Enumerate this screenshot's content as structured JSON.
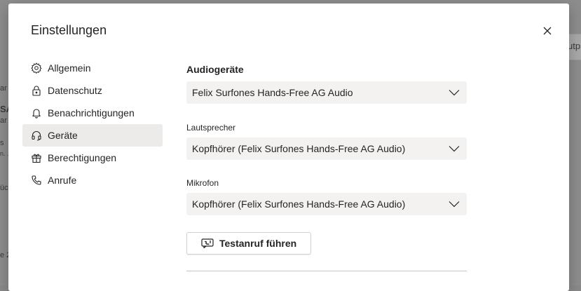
{
  "background": {
    "fragments": [
      "ar",
      "SA",
      "ar",
      "s",
      "n. ...",
      "üc",
      "e 2",
      "utp"
    ]
  },
  "dialog": {
    "title": "Einstellungen",
    "close_icon": "close-icon"
  },
  "nav": {
    "items": [
      {
        "label": "Allgemein",
        "icon": "gear-icon"
      },
      {
        "label": "Datenschutz",
        "icon": "lock-icon"
      },
      {
        "label": "Benachrichtigungen",
        "icon": "bell-icon"
      },
      {
        "label": "Geräte",
        "icon": "headset-icon",
        "active": true
      },
      {
        "label": "Berechtigungen",
        "icon": "gift-box-icon"
      },
      {
        "label": "Anrufe",
        "icon": "phone-icon"
      }
    ]
  },
  "devices": {
    "audio_title": "Audiogeräte",
    "audio_value": "Felix Surfones Hands-Free AG Audio",
    "speaker_label": "Lautsprecher",
    "speaker_value": "Kopfhörer (Felix Surfones Hands-Free AG Audio)",
    "mic_label": "Mikrofon",
    "mic_value": "Kopfhörer (Felix Surfones Hands-Free AG Audio)",
    "test_call_label": "Testanruf führen",
    "test_call_icon": "test-call-icon"
  },
  "colors": {
    "active_nav_bg": "#edebe9",
    "select_bg": "#f3f2f1"
  }
}
